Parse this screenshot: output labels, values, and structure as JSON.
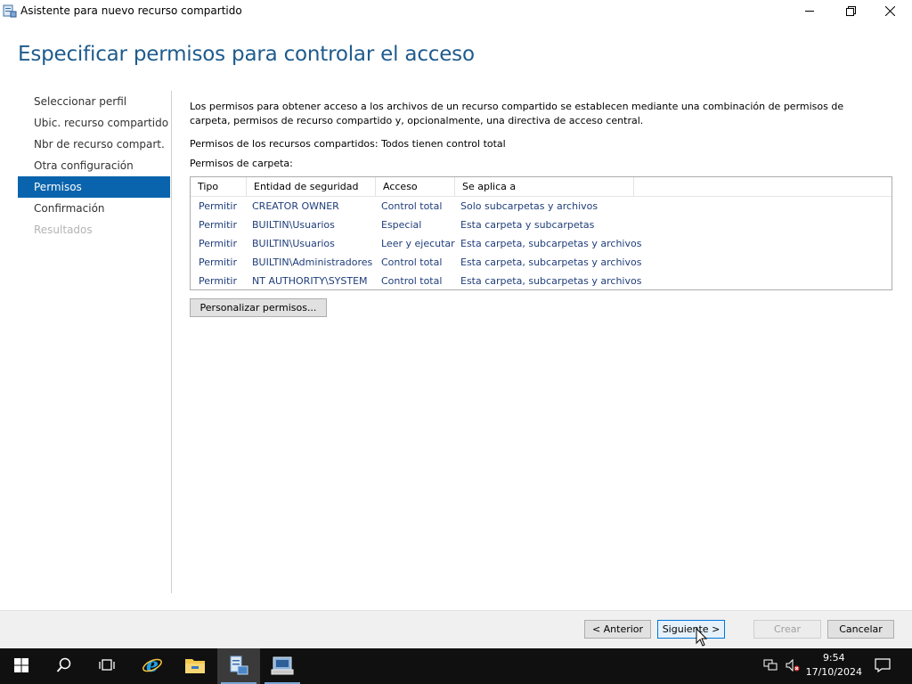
{
  "window": {
    "title": "Asistente para nuevo recurso compartido",
    "minimize_icon": "minimize-icon",
    "restore_icon": "restore-icon",
    "close_icon": "close-icon"
  },
  "page": {
    "title": "Especificar permisos para controlar el acceso"
  },
  "nav": {
    "items": [
      {
        "label": "Seleccionar perfil",
        "state": "normal"
      },
      {
        "label": "Ubic. recurso compartido",
        "state": "normal"
      },
      {
        "label": "Nbr de recurso compart.",
        "state": "normal"
      },
      {
        "label": "Otra configuración",
        "state": "normal"
      },
      {
        "label": "Permisos",
        "state": "active"
      },
      {
        "label": "Confirmación",
        "state": "normal"
      },
      {
        "label": "Resultados",
        "state": "disabled"
      }
    ]
  },
  "content": {
    "description": "Los permisos para obtener acceso a los archivos de un recurso compartido se establecen mediante una combinación de permisos de carpeta, permisos de recurso compartido y, opcionalmente, una directiva de acceso central.",
    "share_permissions": "Permisos de los recursos compartidos: Todos tienen control total",
    "folder_permissions_label": "Permisos de carpeta:",
    "table": {
      "headers": [
        "Tipo",
        "Entidad de seguridad",
        "Acceso",
        "Se aplica a"
      ],
      "rows": [
        [
          "Permitir",
          "CREATOR OWNER",
          "Control total",
          "Solo subcarpetas y archivos"
        ],
        [
          "Permitir",
          "BUILTIN\\Usuarios",
          "Especial",
          "Esta carpeta y subcarpetas"
        ],
        [
          "Permitir",
          "BUILTIN\\Usuarios",
          "Leer y ejecutar",
          "Esta carpeta, subcarpetas y archivos"
        ],
        [
          "Permitir",
          "BUILTIN\\Administradores",
          "Control total",
          "Esta carpeta, subcarpetas y archivos"
        ],
        [
          "Permitir",
          "NT AUTHORITY\\SYSTEM",
          "Control total",
          "Esta carpeta, subcarpetas y archivos"
        ]
      ]
    },
    "customize_button": "Personalizar permisos..."
  },
  "footer": {
    "back_label": "< Anterior",
    "next_label": "Siguiente >",
    "create_label": "Crear",
    "cancel_label": "Cancelar"
  },
  "taskbar": {
    "time": "9:54",
    "date": "17/10/2024",
    "icons": [
      "windows-start-icon",
      "search-icon",
      "task-view-icon",
      "internet-explorer-icon",
      "file-explorer-icon",
      "share-wizard-icon",
      "server-manager-icon"
    ]
  },
  "colors": {
    "accent": "#0a64ad",
    "title_blue": "#1e5b8d",
    "table_text": "#1f3d7a"
  }
}
